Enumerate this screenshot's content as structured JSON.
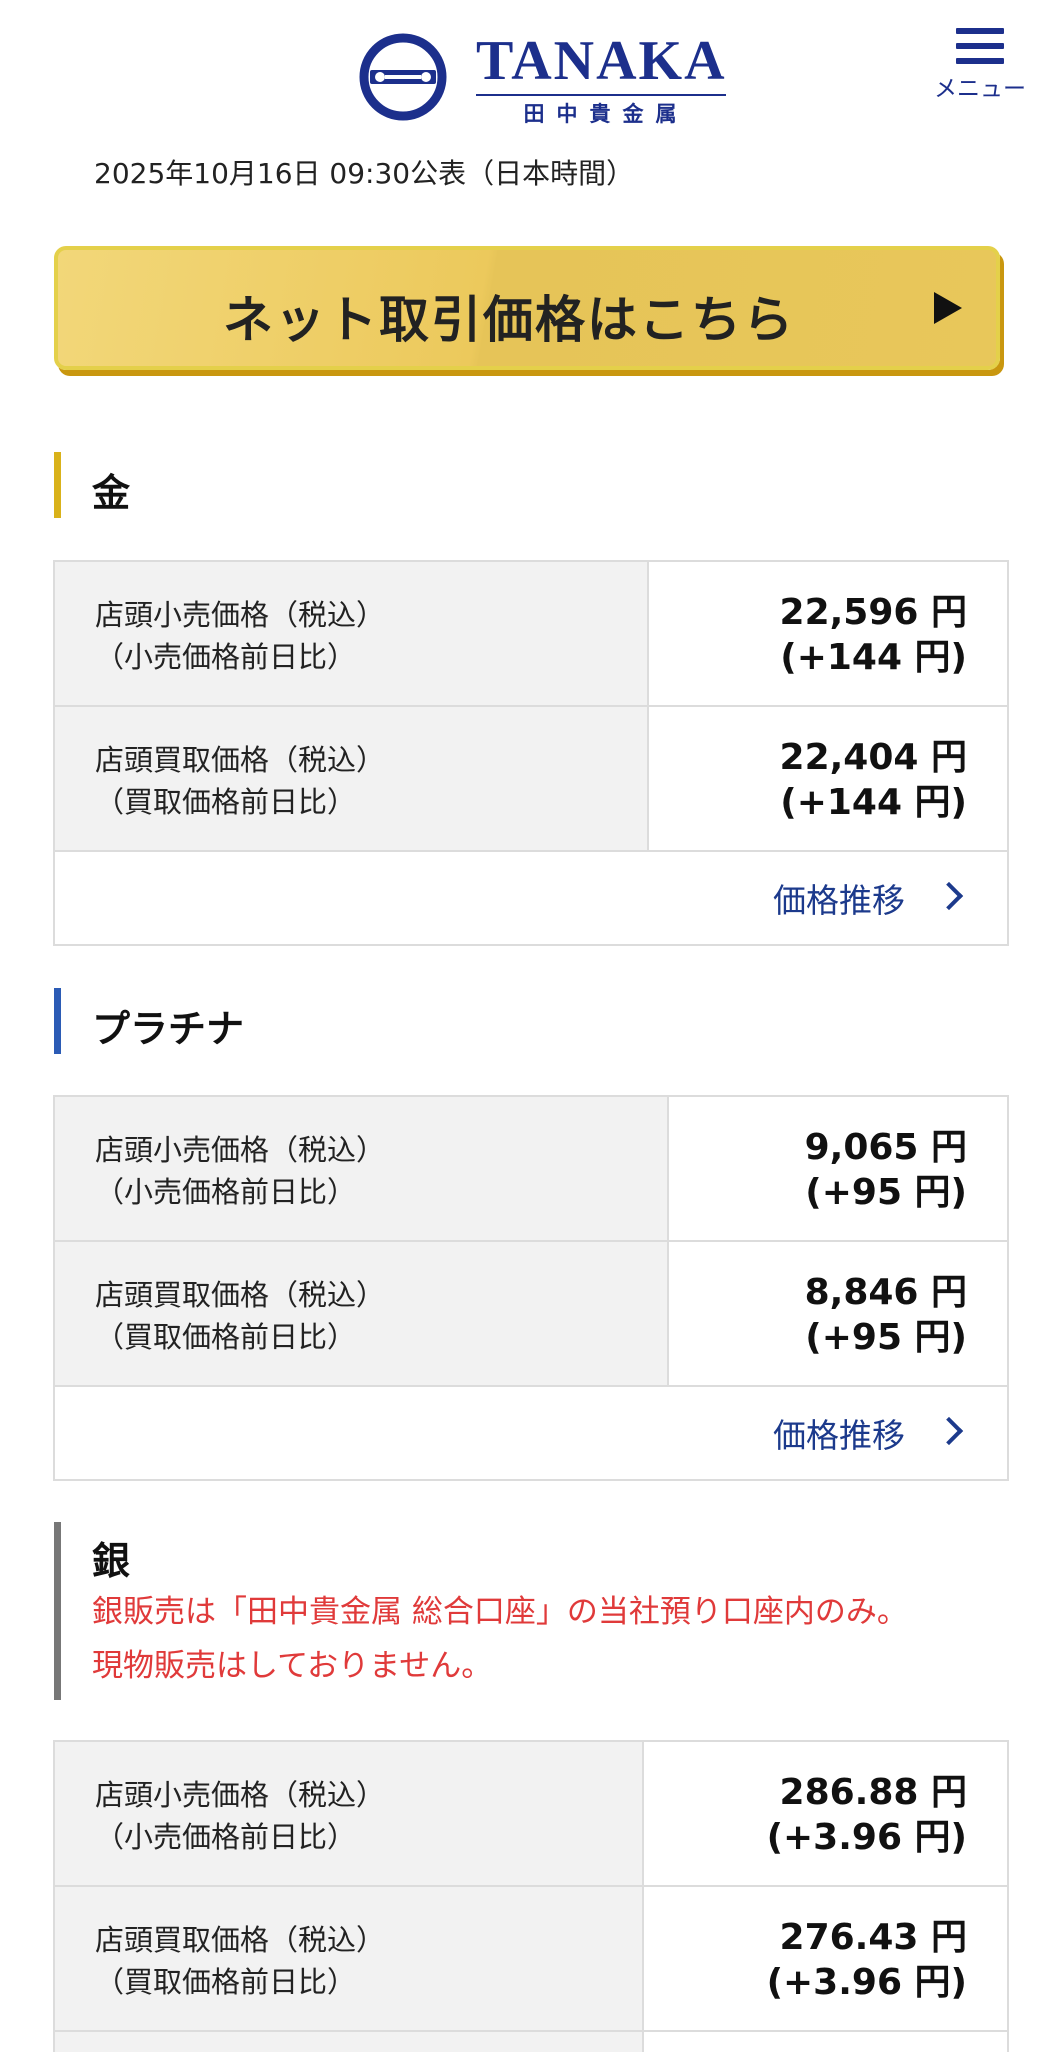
{
  "header": {
    "logo_name": "TANAKA",
    "logo_sub": "田中貴金属",
    "menu_label": "メニュー"
  },
  "announce": "2025年10月16日 09:30公表（日本時間）",
  "cta": {
    "label": "ネット取引価格はこちら"
  },
  "colors": {
    "brand": "#1c2f8c",
    "gold_bar": "#d9b21a",
    "platinum_bar": "#2b5bb5",
    "silver_bar": "#777777",
    "note_red": "#e03a3a"
  },
  "sections": {
    "gold": {
      "title": "金",
      "rows": [
        {
          "label1": "店頭小売価格（税込）",
          "label2": "（小売価格前日比）",
          "value": "22,596 円",
          "change": "(+144 円)"
        },
        {
          "label1": "店頭買取価格（税込）",
          "label2": "（買取価格前日比）",
          "value": "22,404 円",
          "change": "(+144 円)"
        }
      ],
      "trend": "価格推移"
    },
    "platinum": {
      "title": "プラチナ",
      "rows": [
        {
          "label1": "店頭小売価格（税込）",
          "label2": "（小売価格前日比）",
          "value": "9,065 円",
          "change": "(+95 円)"
        },
        {
          "label1": "店頭買取価格（税込）",
          "label2": "（買取価格前日比）",
          "value": "8,846 円",
          "change": "(+95 円)"
        }
      ],
      "trend": "価格推移"
    },
    "silver": {
      "title": "銀",
      "note1": "銀販売は「田中貴金属 総合口座」の当社預り口座内のみ。",
      "note2": "現物販売はしておりません。",
      "rows": [
        {
          "label1": "店頭小売価格（税込）",
          "label2": "（小売価格前日比）",
          "value": "286.88 円",
          "change": "(+3.96 円)"
        },
        {
          "label1": "店頭買取価格（税込）",
          "label2": "（買取価格前日比）",
          "value": "276.43 円",
          "change": "(+3.96 円)"
        }
      ]
    }
  }
}
